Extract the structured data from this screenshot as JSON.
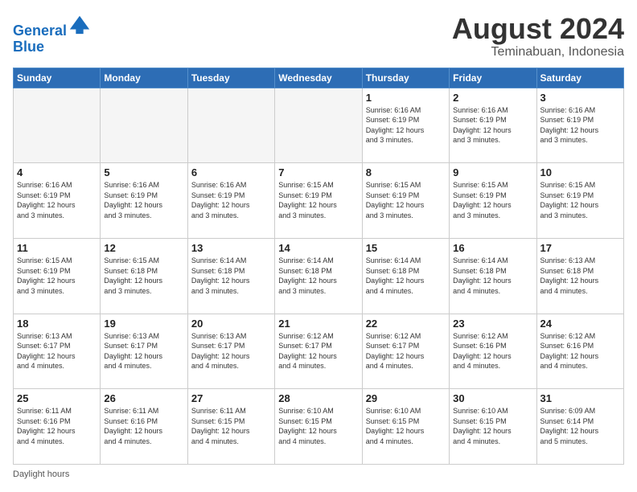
{
  "logo": {
    "line1": "General",
    "line2": "Blue"
  },
  "header": {
    "month_year": "August 2024",
    "location": "Teminabuan, Indonesia"
  },
  "weekdays": [
    "Sunday",
    "Monday",
    "Tuesday",
    "Wednesday",
    "Thursday",
    "Friday",
    "Saturday"
  ],
  "weeks": [
    [
      {
        "day": "",
        "info": "",
        "empty": true
      },
      {
        "day": "",
        "info": "",
        "empty": true
      },
      {
        "day": "",
        "info": "",
        "empty": true
      },
      {
        "day": "",
        "info": "",
        "empty": true
      },
      {
        "day": "1",
        "info": "Sunrise: 6:16 AM\nSunset: 6:19 PM\nDaylight: 12 hours\nand 3 minutes."
      },
      {
        "day": "2",
        "info": "Sunrise: 6:16 AM\nSunset: 6:19 PM\nDaylight: 12 hours\nand 3 minutes."
      },
      {
        "day": "3",
        "info": "Sunrise: 6:16 AM\nSunset: 6:19 PM\nDaylight: 12 hours\nand 3 minutes."
      }
    ],
    [
      {
        "day": "4",
        "info": "Sunrise: 6:16 AM\nSunset: 6:19 PM\nDaylight: 12 hours\nand 3 minutes."
      },
      {
        "day": "5",
        "info": "Sunrise: 6:16 AM\nSunset: 6:19 PM\nDaylight: 12 hours\nand 3 minutes."
      },
      {
        "day": "6",
        "info": "Sunrise: 6:16 AM\nSunset: 6:19 PM\nDaylight: 12 hours\nand 3 minutes."
      },
      {
        "day": "7",
        "info": "Sunrise: 6:15 AM\nSunset: 6:19 PM\nDaylight: 12 hours\nand 3 minutes."
      },
      {
        "day": "8",
        "info": "Sunrise: 6:15 AM\nSunset: 6:19 PM\nDaylight: 12 hours\nand 3 minutes."
      },
      {
        "day": "9",
        "info": "Sunrise: 6:15 AM\nSunset: 6:19 PM\nDaylight: 12 hours\nand 3 minutes."
      },
      {
        "day": "10",
        "info": "Sunrise: 6:15 AM\nSunset: 6:19 PM\nDaylight: 12 hours\nand 3 minutes."
      }
    ],
    [
      {
        "day": "11",
        "info": "Sunrise: 6:15 AM\nSunset: 6:19 PM\nDaylight: 12 hours\nand 3 minutes."
      },
      {
        "day": "12",
        "info": "Sunrise: 6:15 AM\nSunset: 6:18 PM\nDaylight: 12 hours\nand 3 minutes."
      },
      {
        "day": "13",
        "info": "Sunrise: 6:14 AM\nSunset: 6:18 PM\nDaylight: 12 hours\nand 3 minutes."
      },
      {
        "day": "14",
        "info": "Sunrise: 6:14 AM\nSunset: 6:18 PM\nDaylight: 12 hours\nand 3 minutes."
      },
      {
        "day": "15",
        "info": "Sunrise: 6:14 AM\nSunset: 6:18 PM\nDaylight: 12 hours\nand 4 minutes."
      },
      {
        "day": "16",
        "info": "Sunrise: 6:14 AM\nSunset: 6:18 PM\nDaylight: 12 hours\nand 4 minutes."
      },
      {
        "day": "17",
        "info": "Sunrise: 6:13 AM\nSunset: 6:18 PM\nDaylight: 12 hours\nand 4 minutes."
      }
    ],
    [
      {
        "day": "18",
        "info": "Sunrise: 6:13 AM\nSunset: 6:17 PM\nDaylight: 12 hours\nand 4 minutes."
      },
      {
        "day": "19",
        "info": "Sunrise: 6:13 AM\nSunset: 6:17 PM\nDaylight: 12 hours\nand 4 minutes."
      },
      {
        "day": "20",
        "info": "Sunrise: 6:13 AM\nSunset: 6:17 PM\nDaylight: 12 hours\nand 4 minutes."
      },
      {
        "day": "21",
        "info": "Sunrise: 6:12 AM\nSunset: 6:17 PM\nDaylight: 12 hours\nand 4 minutes."
      },
      {
        "day": "22",
        "info": "Sunrise: 6:12 AM\nSunset: 6:17 PM\nDaylight: 12 hours\nand 4 minutes."
      },
      {
        "day": "23",
        "info": "Sunrise: 6:12 AM\nSunset: 6:16 PM\nDaylight: 12 hours\nand 4 minutes."
      },
      {
        "day": "24",
        "info": "Sunrise: 6:12 AM\nSunset: 6:16 PM\nDaylight: 12 hours\nand 4 minutes."
      }
    ],
    [
      {
        "day": "25",
        "info": "Sunrise: 6:11 AM\nSunset: 6:16 PM\nDaylight: 12 hours\nand 4 minutes."
      },
      {
        "day": "26",
        "info": "Sunrise: 6:11 AM\nSunset: 6:16 PM\nDaylight: 12 hours\nand 4 minutes."
      },
      {
        "day": "27",
        "info": "Sunrise: 6:11 AM\nSunset: 6:15 PM\nDaylight: 12 hours\nand 4 minutes."
      },
      {
        "day": "28",
        "info": "Sunrise: 6:10 AM\nSunset: 6:15 PM\nDaylight: 12 hours\nand 4 minutes."
      },
      {
        "day": "29",
        "info": "Sunrise: 6:10 AM\nSunset: 6:15 PM\nDaylight: 12 hours\nand 4 minutes."
      },
      {
        "day": "30",
        "info": "Sunrise: 6:10 AM\nSunset: 6:15 PM\nDaylight: 12 hours\nand 4 minutes."
      },
      {
        "day": "31",
        "info": "Sunrise: 6:09 AM\nSunset: 6:14 PM\nDaylight: 12 hours\nand 5 minutes."
      }
    ]
  ],
  "footer": {
    "daylight_label": "Daylight hours"
  }
}
